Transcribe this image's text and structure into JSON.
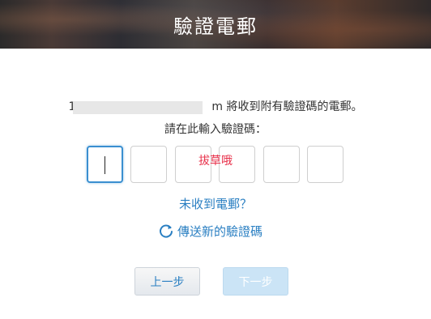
{
  "header": {
    "title": "驗證電郵"
  },
  "info": {
    "email_visible_start": "1",
    "email_visible_end": "m",
    "message_suffix": " 將收到附有驗證碼的電郵。",
    "prompt": "請在此輸入驗證碼："
  },
  "code": {
    "box_count": 6,
    "overlay_text": "拔草哦"
  },
  "links": {
    "no_email": "未收到電郵？",
    "resend": "傳送新的驗證碼",
    "resend_icon": "refresh-icon"
  },
  "buttons": {
    "prev": "上一步",
    "next": "下一步"
  },
  "colors": {
    "link": "#2a7fc2",
    "active_border": "#3a8fd0",
    "overlay": "#e8304a"
  }
}
